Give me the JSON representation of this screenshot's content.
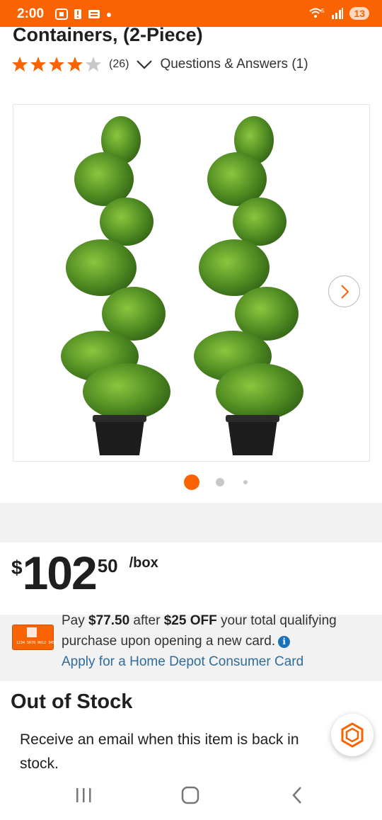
{
  "status_bar": {
    "time": "2:00",
    "network": "5",
    "battery": "13",
    "icons": [
      "screenshot-icon",
      "alert-icon",
      "message-icon",
      "dot-icon",
      "wifi-icon",
      "signal-icon",
      "battery-icon"
    ]
  },
  "product": {
    "title": "Containers, (2-Piece)",
    "rating": 4,
    "rating_max": 5,
    "review_count": "(26)",
    "qa_label": "Questions & Answers (1)"
  },
  "gallery": {
    "image_alt": "Two spiral topiary plants in black containers",
    "current_index": 1,
    "total_images": 3
  },
  "price": {
    "currency": "$",
    "dollars": "102",
    "cents": "50",
    "unit": "/box"
  },
  "promo": {
    "card_number": "1234 5678 9012 3456",
    "line_prefix": "Pay ",
    "discounted_price": "$77.50",
    "line_mid": " after ",
    "discount": "$25 OFF",
    "line_suffix": " your total qualifying purchase upon opening a new card.",
    "apply_link": "Apply for a Home Depot Consumer Card"
  },
  "stock": {
    "title": "Out of Stock",
    "message": "Receive an email when this item is back in stock."
  },
  "colors": {
    "brand_orange": "#f96302",
    "link_blue": "#2f6d9b",
    "star": "#f96302",
    "star_empty": "#c8c8c8"
  }
}
